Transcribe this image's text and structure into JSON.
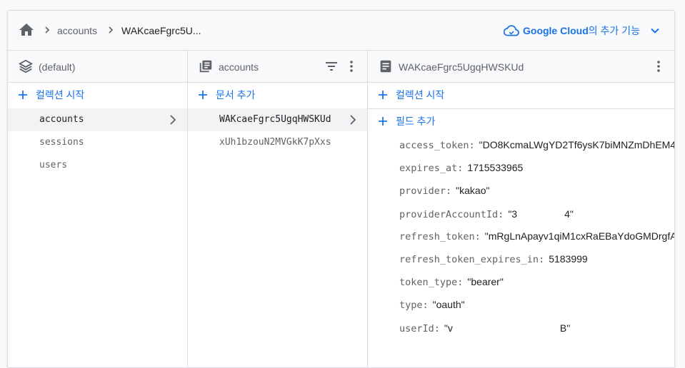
{
  "breadcrumb": {
    "items": [
      "accounts",
      "WAKcaeFgrc5U..."
    ]
  },
  "google_cloud": {
    "brand": "Google Cloud",
    "rest": "의 추가 기능"
  },
  "col1": {
    "title": "(default)",
    "add_label": "컬렉션 시작",
    "items": [
      {
        "label": "accounts",
        "selected": true
      },
      {
        "label": "sessions",
        "selected": false
      },
      {
        "label": "users",
        "selected": false
      }
    ]
  },
  "col2": {
    "title": "accounts",
    "add_label": "문서 추가",
    "items": [
      {
        "label": "WAKcaeFgrc5UgqHWSKUd",
        "selected": true
      },
      {
        "label": "xUh1bzouN2MVGkK7pXxs",
        "selected": false
      }
    ]
  },
  "col3": {
    "title": "WAKcaeFgrc5UgqHWSKUd",
    "add_collection_label": "컬렉션 시작",
    "add_field_label": "필드 추가",
    "fields": [
      {
        "key": "access_token:",
        "value": "\"DO8KcmaLWgYD2Tf6ysK7biMNZmDhEM4"
      },
      {
        "key": "expires_at:",
        "value": "1715533965"
      },
      {
        "key": "provider:",
        "value": "\"kakao\""
      },
      {
        "key": "providerAccountId:",
        "value": "\"3",
        "value_end": "4\""
      },
      {
        "key": "refresh_token:",
        "value": "\"mRgLnApayv1qiM1cxRaEBaYdoGMDrgfA"
      },
      {
        "key": "refresh_token_expires_in:",
        "value": "5183999"
      },
      {
        "key": "token_type:",
        "value": "\"bearer\""
      },
      {
        "key": "type:",
        "value": "\"oauth\""
      },
      {
        "key": "userId:",
        "value": "\"v",
        "value_end": "B\""
      }
    ]
  },
  "colors": {
    "accent": "#1a73e8",
    "selected_bg": "#f1f3f4",
    "border": "#dadce0"
  },
  "icons": {
    "home": "home-icon",
    "cloud": "cloud-icon",
    "database": "layers-icon",
    "collection": "collection-icon",
    "document": "document-icon",
    "filter": "filter-icon",
    "more": "more-vert-icon",
    "chevron": "chevron-right-icon"
  }
}
